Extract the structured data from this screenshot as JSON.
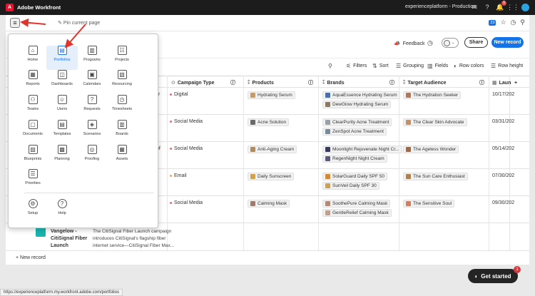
{
  "app": {
    "title": "Adobe Workfront",
    "org": "experienceplatform - Production",
    "notification_count": "6"
  },
  "navbar": {
    "pin_label": "Pin current page",
    "counter": "23"
  },
  "header": {
    "feedback_label": "Feedback",
    "share_label": "Share",
    "new_record_label": "New record"
  },
  "toolbar": {
    "filters": "Filters",
    "sort": "Sort",
    "grouping": "Grouping",
    "fields": "Fields",
    "row_colors": "Row colors",
    "row_height": "Row height"
  },
  "columns": {
    "campaign_type": "Campaign Type",
    "products": "Products",
    "brands": "Brands",
    "target_audience": "Target Audience",
    "launch": "Laun"
  },
  "rows": [
    {
      "type": "Digital",
      "color": "#e86a7a",
      "product": "Hydrating Serum",
      "brands": [
        "AquaEssence Hydrating Serum",
        "DewGlow Hydrating Serum"
      ],
      "audience": "The Hydration Seeker",
      "date": "10/17/202",
      "left": "r"
    },
    {
      "type": "Social Media",
      "color": "#e86a7a",
      "product": "Acne Solution",
      "brands": [
        "ClearPurity Acne Treatment",
        "ZenSpot Acne Treatment"
      ],
      "audience": "The Clear Skin Advocate",
      "date": "03/31/202",
      "left": ""
    },
    {
      "type": "Social Media",
      "color": "#e86a7a",
      "product": "Anti-Aging Cream",
      "brands": [
        "Moonlight Rejuvenate Night Cr...",
        "RegenNight Night Cream"
      ],
      "audience": "The Ageless Wonder",
      "date": "05/14/202",
      "left": "of"
    },
    {
      "type": "Email",
      "color": "#f0a35a",
      "product": "Daily Sunscreen",
      "brands": [
        "SolarGuard Daily SPF 50",
        "SunVeil Daily SPF 30"
      ],
      "audience": "The Sun Care Enthusiast",
      "date": "07/30/202",
      "left": ""
    },
    {
      "type": "Social Media",
      "color": "#e86a7a",
      "product": "Calming Mask",
      "brands": [
        "SoothePure Calming Mask",
        "GentleRelief Calming Mask"
      ],
      "audience": "The Sensitive Soul",
      "date": "09/30/202",
      "left": ""
    }
  ],
  "last_row": {
    "title_lines": [
      "Vangelow -",
      "CitiSignal Fiber",
      "Launch"
    ],
    "desc_lines": [
      "The CitiSignal Fiber Launch campaign",
      "introduces CitiSignal's flagship fiber",
      "internet service—CitiSignal Fiber Max..."
    ]
  },
  "new_record_row": "New record",
  "get_started": {
    "label": "Get started",
    "badge": "1"
  },
  "status_url": "https://experienceplatform.my.workfront.adobe.com/portfolios",
  "menu": {
    "items": [
      {
        "label": "Home",
        "icon": "home-icon",
        "glyph": "⌂"
      },
      {
        "label": "Portfolios",
        "icon": "portfolio-icon",
        "glyph": "▤"
      },
      {
        "label": "Programs",
        "icon": "programs-icon",
        "glyph": "▥"
      },
      {
        "label": "Projects",
        "icon": "projects-icon",
        "glyph": "☷"
      },
      {
        "label": "Reports",
        "icon": "reports-icon",
        "glyph": "▦"
      },
      {
        "label": "Dashboards",
        "icon": "dashboards-icon",
        "glyph": "◫"
      },
      {
        "label": "Calendars",
        "icon": "calendars-icon",
        "glyph": "▣"
      },
      {
        "label": "Resourcing",
        "icon": "resourcing-icon",
        "glyph": "▧"
      },
      {
        "label": "Teams",
        "icon": "teams-icon",
        "glyph": "⚇"
      },
      {
        "label": "Users",
        "icon": "users-icon",
        "glyph": "☺"
      },
      {
        "label": "Requests",
        "icon": "requests-icon",
        "glyph": "?"
      },
      {
        "label": "Timesheets",
        "icon": "timesheets-icon",
        "glyph": "◷"
      },
      {
        "label": "Documents",
        "icon": "documents-icon",
        "glyph": "▢"
      },
      {
        "label": "Templates",
        "icon": "templates-icon",
        "glyph": "▤"
      },
      {
        "label": "Scenarios",
        "icon": "scenarios-icon",
        "glyph": "◈"
      },
      {
        "label": "Boards",
        "icon": "boards-icon",
        "glyph": "▥"
      },
      {
        "label": "Blueprints",
        "icon": "blueprints-icon",
        "glyph": "▨"
      },
      {
        "label": "Planning",
        "icon": "planning-icon",
        "glyph": "▩"
      },
      {
        "label": "Proofing",
        "icon": "proofing-icon",
        "glyph": "◎"
      },
      {
        "label": "Assets",
        "icon": "assets-icon",
        "glyph": "▦"
      },
      {
        "label": "Priorities",
        "icon": "priorities-icon",
        "glyph": "☰"
      },
      {
        "label": "Setup",
        "icon": "setup-icon",
        "glyph": "⚙"
      },
      {
        "label": "Help",
        "icon": "help-icon",
        "glyph": "?"
      }
    ]
  },
  "colors": {
    "accent": "#1473e6",
    "annotation": "#e2342b"
  }
}
